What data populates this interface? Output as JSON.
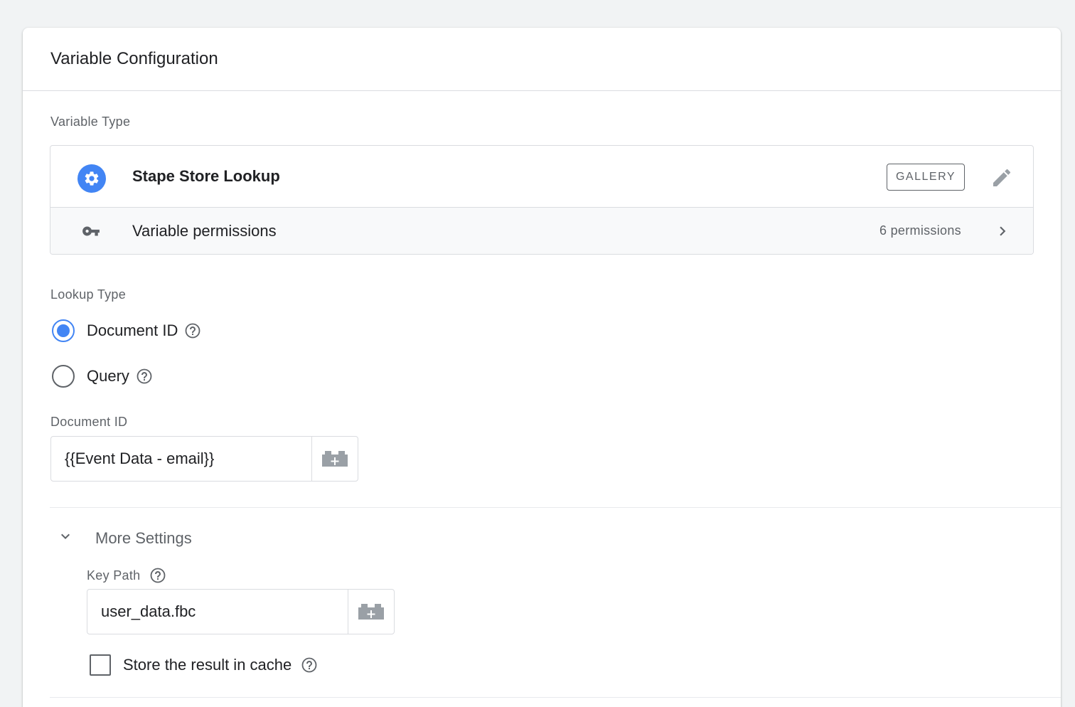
{
  "header": {
    "title": "Variable Configuration"
  },
  "variable_type": {
    "section_label": "Variable Type",
    "name": "Stape Store Lookup",
    "gallery_label": "GALLERY",
    "permissions_label": "Variable permissions",
    "permissions_count": "6 permissions"
  },
  "lookup_type": {
    "section_label": "Lookup Type",
    "options": [
      {
        "label": "Document ID",
        "checked": true
      },
      {
        "label": "Query",
        "checked": false
      }
    ]
  },
  "document_id": {
    "label": "Document ID",
    "value": "{{Event Data - email}}"
  },
  "more_settings": {
    "label": "More Settings",
    "key_path_label": "Key Path",
    "key_path_value": "user_data.fbc",
    "cache_label": "Store the result in cache",
    "cache_checked": false
  },
  "colors": {
    "accent": "#4285f4",
    "border": "#dadce0",
    "text_secondary": "#5f6368"
  },
  "icons": [
    "gear-icon",
    "pencil-icon",
    "key-icon",
    "chevron-right-icon",
    "help-icon",
    "variable-picker-icon",
    "chevron-down-icon"
  ]
}
